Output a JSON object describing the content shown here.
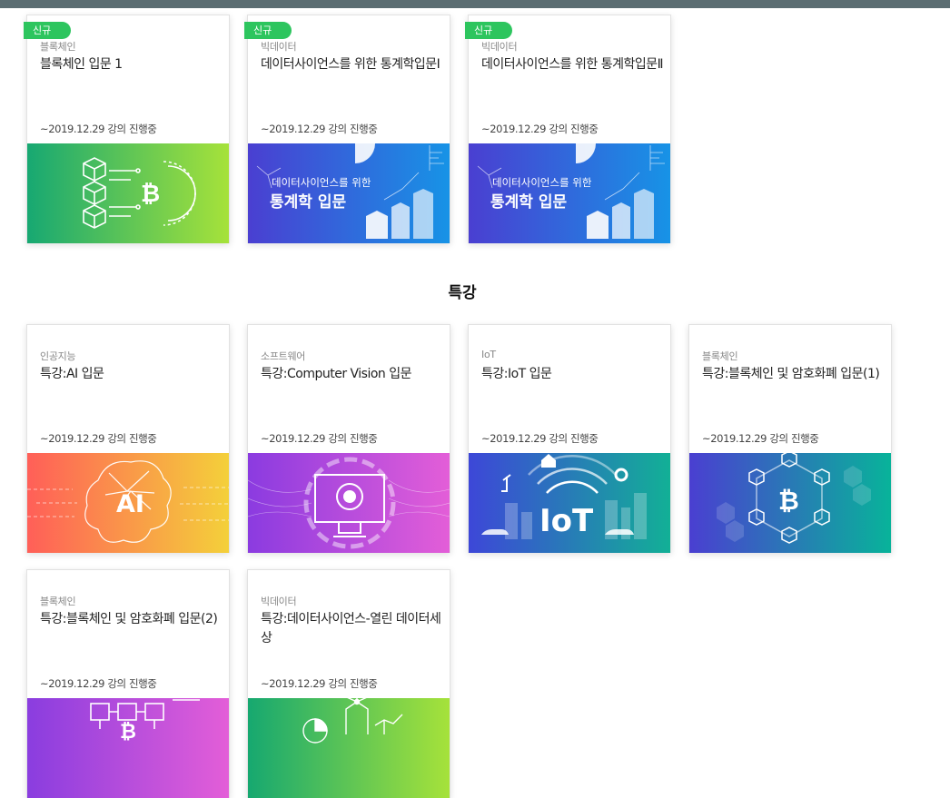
{
  "badge_new": "신규",
  "section_title": "특강",
  "cards": [
    {
      "category": "블록체인",
      "title": "블록체인 입문 1",
      "date": "~2019.12.29 강의 진행중",
      "thumb": "blockchain-thumbnail"
    },
    {
      "category": "빅데이터",
      "title": "데이터사이언스를 위한 통계학입문Ⅰ",
      "date": "~2019.12.29 강의 진행중",
      "thumb": "statistics-thumbnail",
      "thumb_line1": "데이터사이언스를 위한",
      "thumb_line2": "통계학 입문"
    },
    {
      "category": "빅데이터",
      "title": "데이터사이언스를 위한 통계학입문Ⅱ",
      "date": "~2019.12.29 강의 진행중",
      "thumb": "statistics-thumbnail",
      "thumb_line1": "데이터사이언스를 위한",
      "thumb_line2": "통계학 입문"
    },
    {
      "category": "인공지능",
      "title": "특강:AI 입문",
      "date": "~2019.12.29 강의 진행중",
      "thumb": "ai-brain-thumbnail",
      "thumb_text": "AI"
    },
    {
      "category": "소프트웨어",
      "title": "특강:Computer Vision 입문",
      "date": "~2019.12.29 강의 진행중",
      "thumb": "computer-vision-thumbnail"
    },
    {
      "category": "IoT",
      "title": "특강:IoT 입문",
      "date": "~2019.12.29 강의 진행중",
      "thumb": "iot-thumbnail",
      "thumb_text": "IoT"
    },
    {
      "category": "블록체인",
      "title": "특강:블록체인 및 암호화폐 입문(1)",
      "date": "~2019.12.29 강의 진행중",
      "thumb": "crypto-thumbnail"
    },
    {
      "category": "블록체인",
      "title": "특강:블록체인 및 암호화폐 입문(2)",
      "date": "~2019.12.29 강의 진행중",
      "thumb": "crypto-thumbnail"
    },
    {
      "category": "빅데이터",
      "title": "특강:데이터사이언스-열린 데이터세상",
      "date": "~2019.12.29 강의 진행중",
      "thumb": "open-data-thumbnail"
    }
  ],
  "colors": {
    "badge": "#2dc55e",
    "topbar": "#5b6d72"
  }
}
